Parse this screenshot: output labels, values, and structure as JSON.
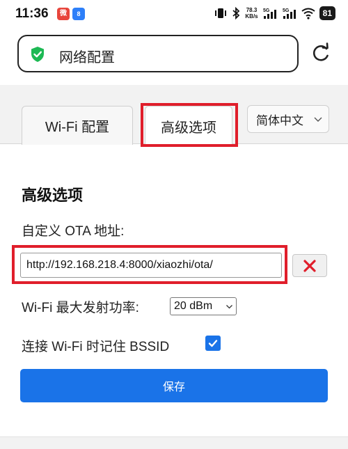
{
  "status_bar": {
    "time": "11:36",
    "app_badge_1": "微",
    "app_badge_2": "8",
    "net_speed_top": "78.3",
    "net_speed_bottom": "KB/s",
    "signal_label_1": "5G",
    "signal_label_2": "5G",
    "battery": "81",
    "icons": [
      "vibrate-icon",
      "bluetooth-icon",
      "signal-icon",
      "signal-icon",
      "wifi-icon",
      "battery-icon"
    ]
  },
  "header": {
    "url_text": "网络配置",
    "shield_color": "#1db954",
    "reload_icon": "reload-icon"
  },
  "tabs": [
    {
      "label": "Wi-Fi 配置",
      "active": false
    },
    {
      "label": "高级选项",
      "active": true
    }
  ],
  "language": {
    "selected": "简体中文"
  },
  "main": {
    "section_title": "高级选项",
    "ota_label": "自定义 OTA 地址:",
    "ota_value": "http://192.168.218.4:8000/xiaozhi/ota/",
    "clear_icon": "close-icon",
    "power_label": "Wi-Fi 最大发射功率:",
    "power_selected": "20 dBm",
    "bssid_label": "连接 Wi-Fi 时记住 BSSID",
    "bssid_checked": true,
    "save_label": "保存"
  },
  "colors": {
    "accent": "#1a73e8",
    "highlight": "#e01e2b"
  }
}
